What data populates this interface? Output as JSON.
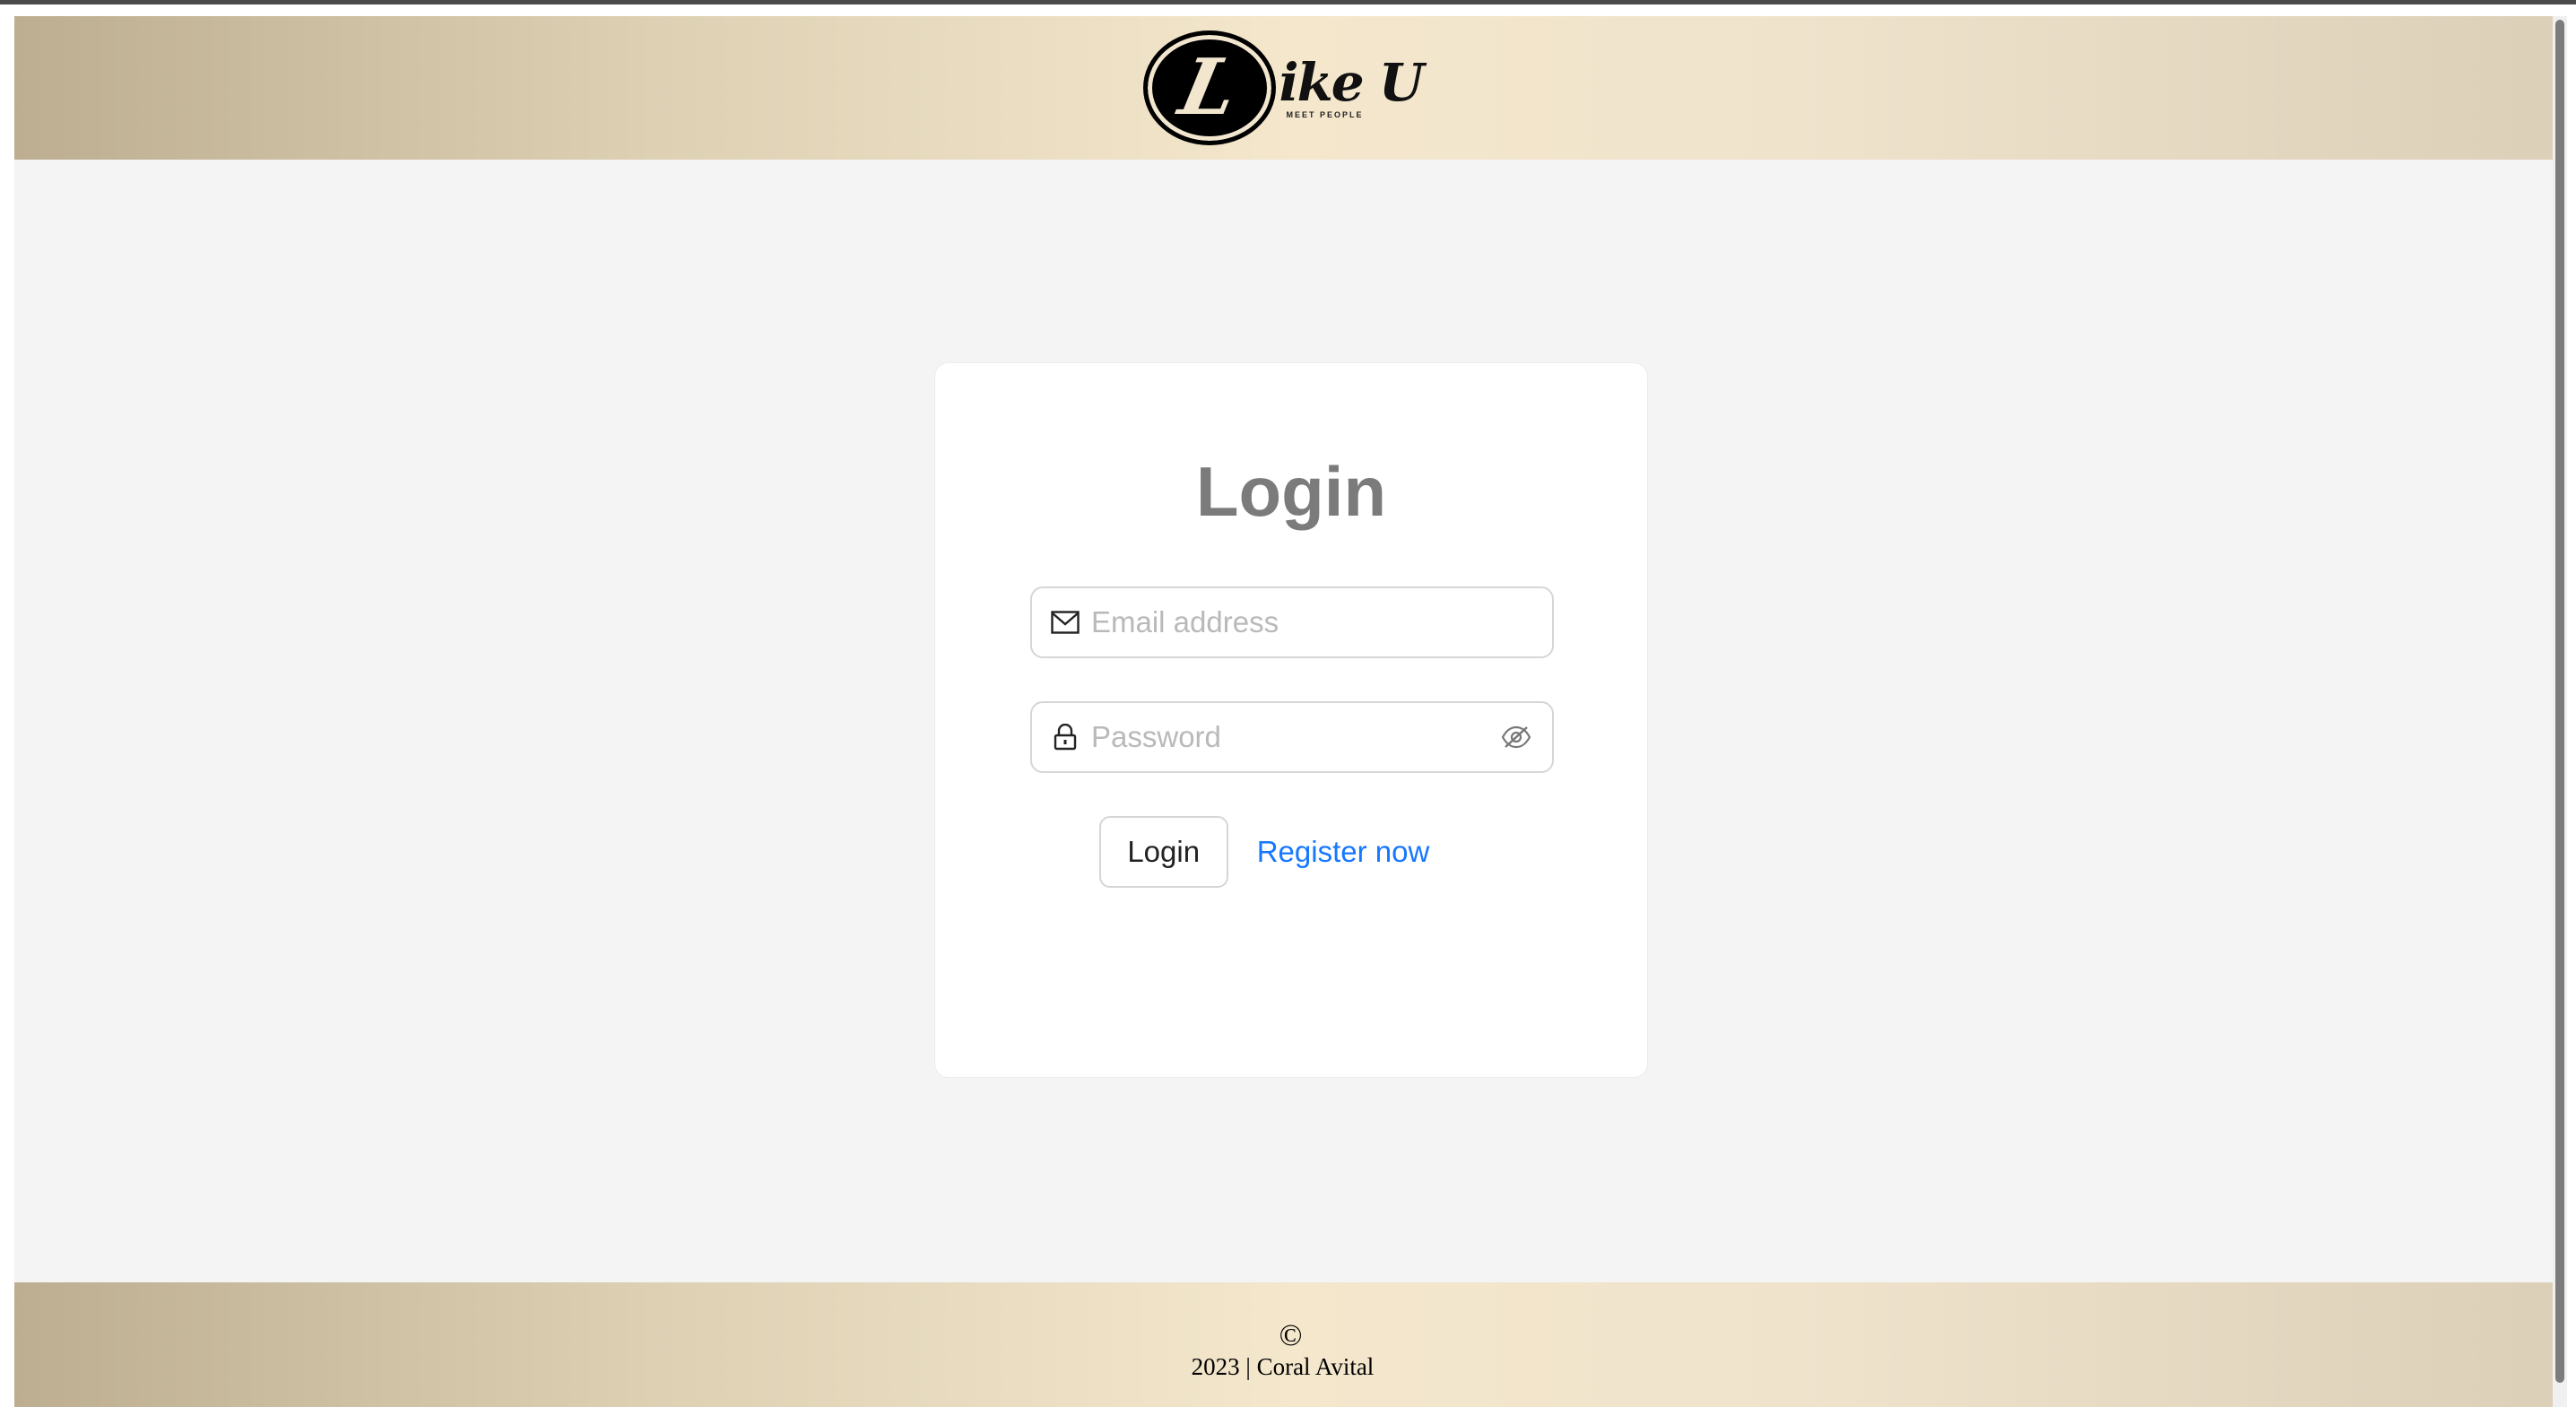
{
  "header": {
    "logo": {
      "letter": "L",
      "word": "ike U",
      "tagline": "MEET PEOPLE"
    }
  },
  "login_card": {
    "title": "Login",
    "email": {
      "icon": "mail-icon",
      "placeholder": "Email address",
      "value": ""
    },
    "password": {
      "icon": "lock-icon",
      "placeholder": "Password",
      "value": "",
      "toggle_icon": "eye-invisible-icon"
    },
    "login_button": "Login",
    "register_link": "Register now"
  },
  "footer": {
    "copyright_symbol": "©",
    "text": "2023 | Coral Avital"
  },
  "colors": {
    "link": "#1677ff",
    "title": "#7b7b7b",
    "header_gradient_start": "#bdae91",
    "header_gradient_mid": "#f4e7cc"
  }
}
